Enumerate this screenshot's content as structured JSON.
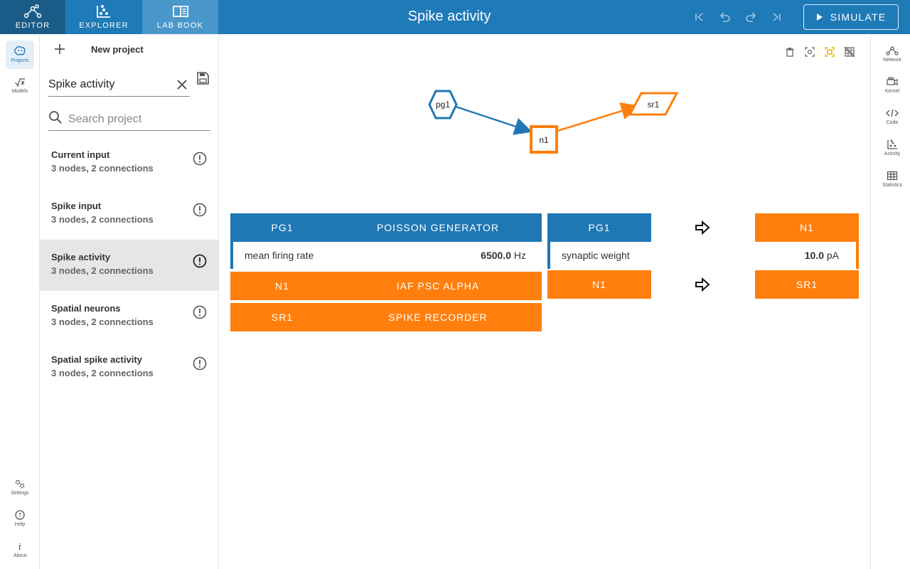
{
  "topbar": {
    "tabs": [
      {
        "label": "EDITOR",
        "icon": "network-icon"
      },
      {
        "label": "EXPLORER",
        "icon": "scatter-icon"
      },
      {
        "label": "LAB BOOK",
        "icon": "book-icon"
      }
    ],
    "title": "Spike activity",
    "simulate_label": "SIMULATE",
    "history_icons": [
      "first-icon",
      "undo-icon",
      "redo-icon",
      "last-icon"
    ]
  },
  "left_rail": {
    "projects": "Projects",
    "models": "Models",
    "settings": "Settings",
    "help": "Help",
    "about": "About"
  },
  "panel": {
    "new_project": "New project",
    "project_name": "Spike activity",
    "search_placeholder": "Search project",
    "projects": [
      {
        "name": "Current input",
        "meta": "3 nodes, 2 connections",
        "active": false
      },
      {
        "name": "Spike input",
        "meta": "3 nodes, 2 connections",
        "active": false
      },
      {
        "name": "Spike activity",
        "meta": "3 nodes, 2 connections",
        "active": true
      },
      {
        "name": "Spatial neurons",
        "meta": "3 nodes, 2 connections",
        "active": false
      },
      {
        "name": "Spatial spike activity",
        "meta": "3 nodes, 2 connections",
        "active": false
      }
    ]
  },
  "graph": {
    "nodes": [
      {
        "id": "pg1",
        "color": "#1f77b4"
      },
      {
        "id": "n1",
        "color": "#ff7f0e"
      },
      {
        "id": "sr1",
        "color": "#ff7f0e"
      }
    ]
  },
  "nodes_table": {
    "pg1": {
      "id": "PG1",
      "model": "POISSON GENERATOR",
      "param_label": "mean firing rate",
      "param_value": "6500.0",
      "param_unit": "Hz"
    },
    "n1": {
      "id": "N1",
      "model": "IAF PSC ALPHA"
    },
    "sr1": {
      "id": "SR1",
      "model": "SPIKE RECORDER"
    }
  },
  "connections_table": {
    "c1": {
      "source": "PG1",
      "target": "N1",
      "param_label": "synaptic weight",
      "param_value": "10.0",
      "param_unit": "pA"
    },
    "c2": {
      "source": "N1",
      "target": "SR1"
    }
  },
  "right_rail": {
    "network": "Network",
    "kernel": "Kernel",
    "code": "Code",
    "activity": "Activity",
    "statistics": "Statistics"
  },
  "colors": {
    "primary": "#1f7ab8",
    "blue_node": "#1f77b4",
    "orange_node": "#ff7f0e"
  }
}
